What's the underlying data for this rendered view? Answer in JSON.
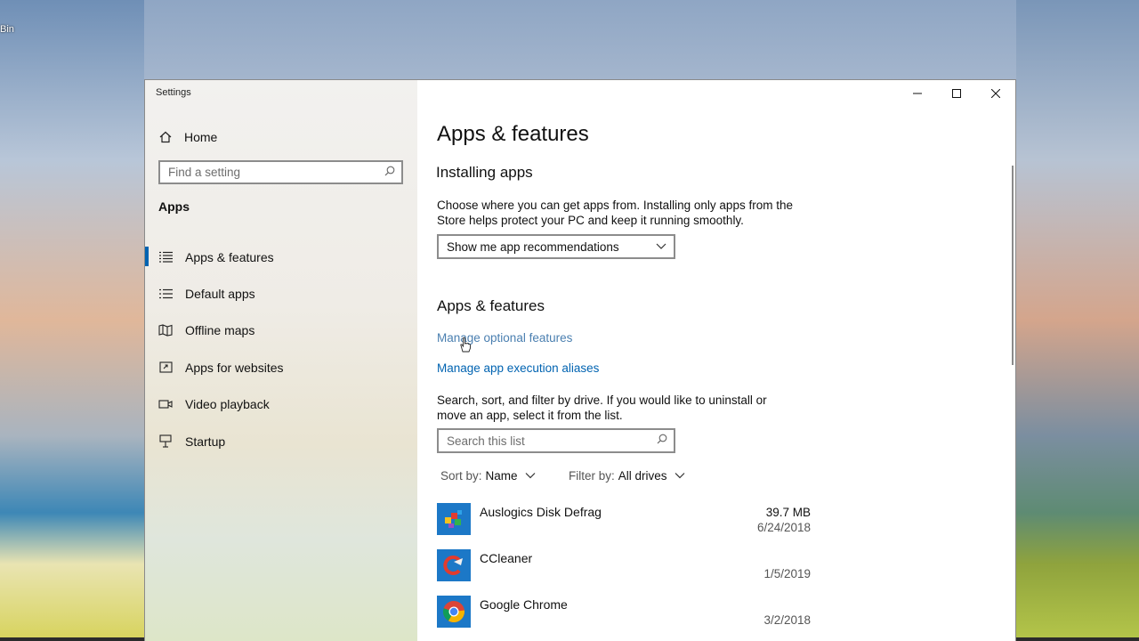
{
  "desktop": {
    "icon_label": "Bin"
  },
  "window": {
    "title": "Settings",
    "controls": {
      "minimize": "—",
      "maximize": "☐",
      "close": "✕"
    }
  },
  "sidebar": {
    "home_label": "Home",
    "search_placeholder": "Find a setting",
    "section_label": "Apps",
    "items": [
      {
        "label": "Apps & features",
        "icon": "list-icon",
        "active": true
      },
      {
        "label": "Default apps",
        "icon": "default-apps-icon",
        "active": false
      },
      {
        "label": "Offline maps",
        "icon": "map-icon",
        "active": false
      },
      {
        "label": "Apps for websites",
        "icon": "website-link-icon",
        "active": false
      },
      {
        "label": "Video playback",
        "icon": "video-icon",
        "active": false
      },
      {
        "label": "Startup",
        "icon": "startup-icon",
        "active": false
      }
    ]
  },
  "main": {
    "page_title": "Apps & features",
    "installing": {
      "heading": "Installing apps",
      "description_line1": "Choose where you can get apps from. Installing only apps from the",
      "description_line2": "Store helps protect your PC and keep it running smoothly.",
      "dropdown_value": "Show me app recommendations"
    },
    "features": {
      "heading": "Apps & features",
      "link_optional": "Manage optional features",
      "link_aliases": "Manage app execution aliases",
      "description_line1": "Search, sort, and filter by drive. If you would like to uninstall or",
      "description_line2": "move an app, select it from the list.",
      "search_placeholder": "Search this list",
      "sort_label": "Sort by:",
      "sort_value": "Name",
      "filter_label": "Filter by:",
      "filter_value": "All drives"
    },
    "apps": [
      {
        "name": "Auslogics Disk Defrag",
        "size": "39.7 MB",
        "date": "6/24/2018"
      },
      {
        "name": "CCleaner",
        "size": "",
        "date": "1/5/2019"
      },
      {
        "name": "Google Chrome",
        "size": "",
        "date": "3/2/2018"
      }
    ]
  },
  "colors": {
    "accent": "#0063b1",
    "app_icon_bg": "#1c78c7"
  }
}
